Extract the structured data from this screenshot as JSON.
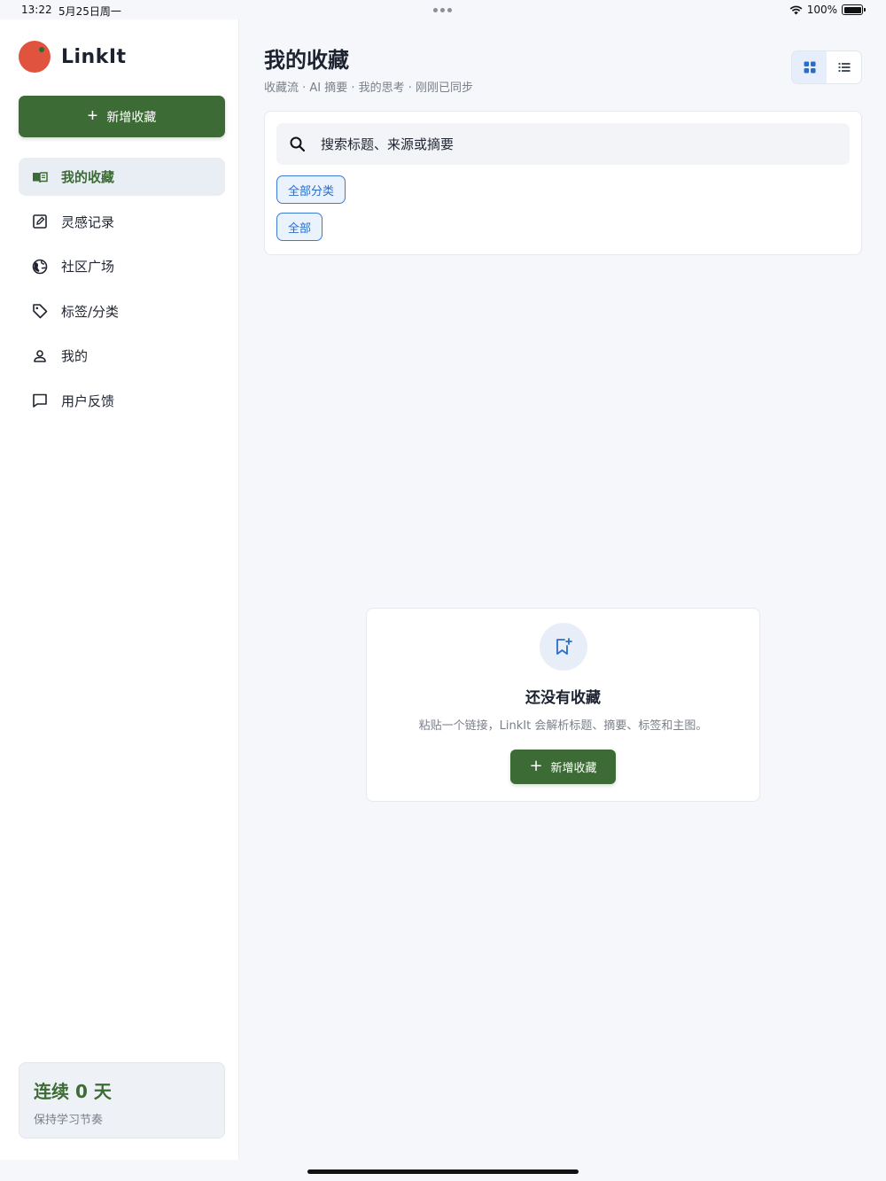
{
  "status_bar": {
    "time": "13:22",
    "date": "5月25日周一",
    "battery": "100%"
  },
  "sidebar": {
    "app_name": "LinkIt",
    "new_button_label": "新增收藏",
    "nav": [
      {
        "label": "我的收藏",
        "icon": "book-open-icon",
        "active": true
      },
      {
        "label": "灵感记录",
        "icon": "note-edit-icon",
        "active": false
      },
      {
        "label": "社区广场",
        "icon": "globe-icon",
        "active": false
      },
      {
        "label": "标签/分类",
        "icon": "tag-icon",
        "active": false
      },
      {
        "label": "我的",
        "icon": "user-icon",
        "active": false
      },
      {
        "label": "用户反馈",
        "icon": "chat-bubble-icon",
        "active": false
      }
    ],
    "streak": {
      "title": "连续 0 天",
      "subtitle": "保持学习节奏"
    }
  },
  "main": {
    "title": "我的收藏",
    "subtitle": "收藏流 · AI 摘要 · 我的思考 · 刚刚已同步",
    "view_toggle": {
      "active": "grid"
    },
    "search": {
      "placeholder": "搜索标题、来源或摘要"
    },
    "filters": {
      "category_chip": "全部分类",
      "all_chip": "全部"
    },
    "empty_state": {
      "title": "还没有收藏",
      "description": "粘贴一个链接，LinkIt 会解析标题、摘要、标签和主图。",
      "button_label": "新增收藏"
    }
  },
  "colors": {
    "brand_green": "#3d6b35",
    "accent_blue": "#3b7ad8",
    "logo_red": "#e0533f"
  }
}
